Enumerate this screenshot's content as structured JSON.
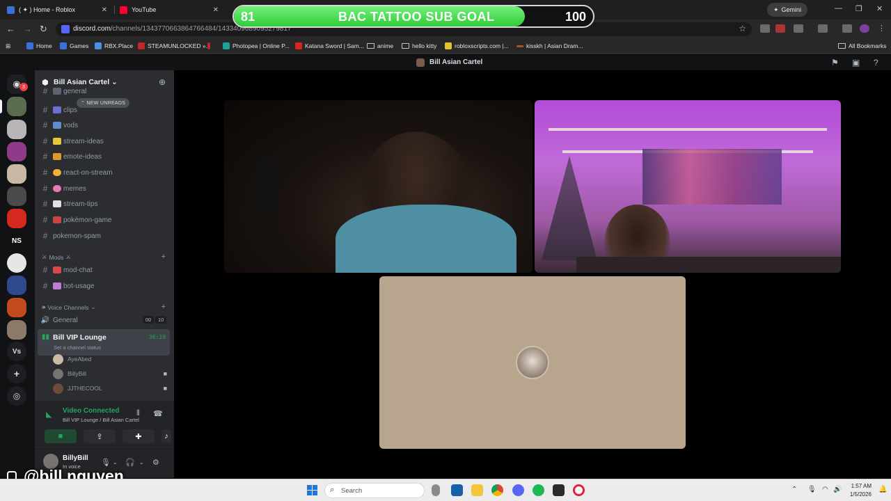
{
  "browser": {
    "tabs": [
      {
        "title": "( ✦ ) Home - Roblox",
        "close": "✕"
      },
      {
        "title": "YouTube",
        "close": "✕"
      }
    ],
    "gemini_label": "Gemini",
    "url_host": "discord.com",
    "url_path": "/channels/1343770663864766484/1433409689095279817",
    "bookmarks": [
      "Home",
      "Games",
      "RBX.Place",
      "STEAMUNLOCKED »...",
      "Photopea | Online P...",
      "Katana Sword | Sam...",
      "anime",
      "hello kitty",
      "robloxscripts.com |...",
      "kisskh | Asian Dram...",
      "All Bookmarks"
    ]
  },
  "stream_goal": {
    "current": "81",
    "title": "BAC TATTOO SUB GOAL",
    "target": "100",
    "progress": 0.81
  },
  "discord": {
    "window_title": "Bill Asian Cartel",
    "guild_badge": "3",
    "guild_labels": {
      "ns": "NS",
      "vs": "Vs"
    },
    "server_name": "Bill Asian Cartel",
    "new_unreads": "NEW UNREADS",
    "channels": [
      {
        "name": "general"
      },
      {
        "name": "clips"
      },
      {
        "name": "vods"
      },
      {
        "name": "stream-ideas"
      },
      {
        "name": "emote-ideas"
      },
      {
        "name": "react-on-stream"
      },
      {
        "name": "memes"
      },
      {
        "name": "stream-tips"
      },
      {
        "name": "pokémon-game"
      },
      {
        "name": "pokemon-spam"
      }
    ],
    "mods_category": "Mods",
    "mod_channels": [
      {
        "name": "mod-chat"
      },
      {
        "name": "bot-usage"
      }
    ],
    "voice_category": "Voice Channels",
    "voice_general": {
      "name": "General",
      "count_a": "00",
      "count_b": "10"
    },
    "voice_active": {
      "name": "Bill VIP Lounge",
      "status": "Set a channel status",
      "time": "36:19"
    },
    "members": [
      "AyeAbed",
      "BillyBill",
      "JJTHECOOL"
    ],
    "voice_panel": {
      "title": "Video Connected",
      "subtitle": "Bill VIP Lounge / Bill Asian Cartel"
    },
    "user": {
      "name": "BillyBill",
      "status": "In voice"
    }
  },
  "watermark": "@bill.nguyen",
  "taskbar": {
    "search_label": "Search",
    "time": "1:57 AM",
    "date": "1/5/2026"
  }
}
